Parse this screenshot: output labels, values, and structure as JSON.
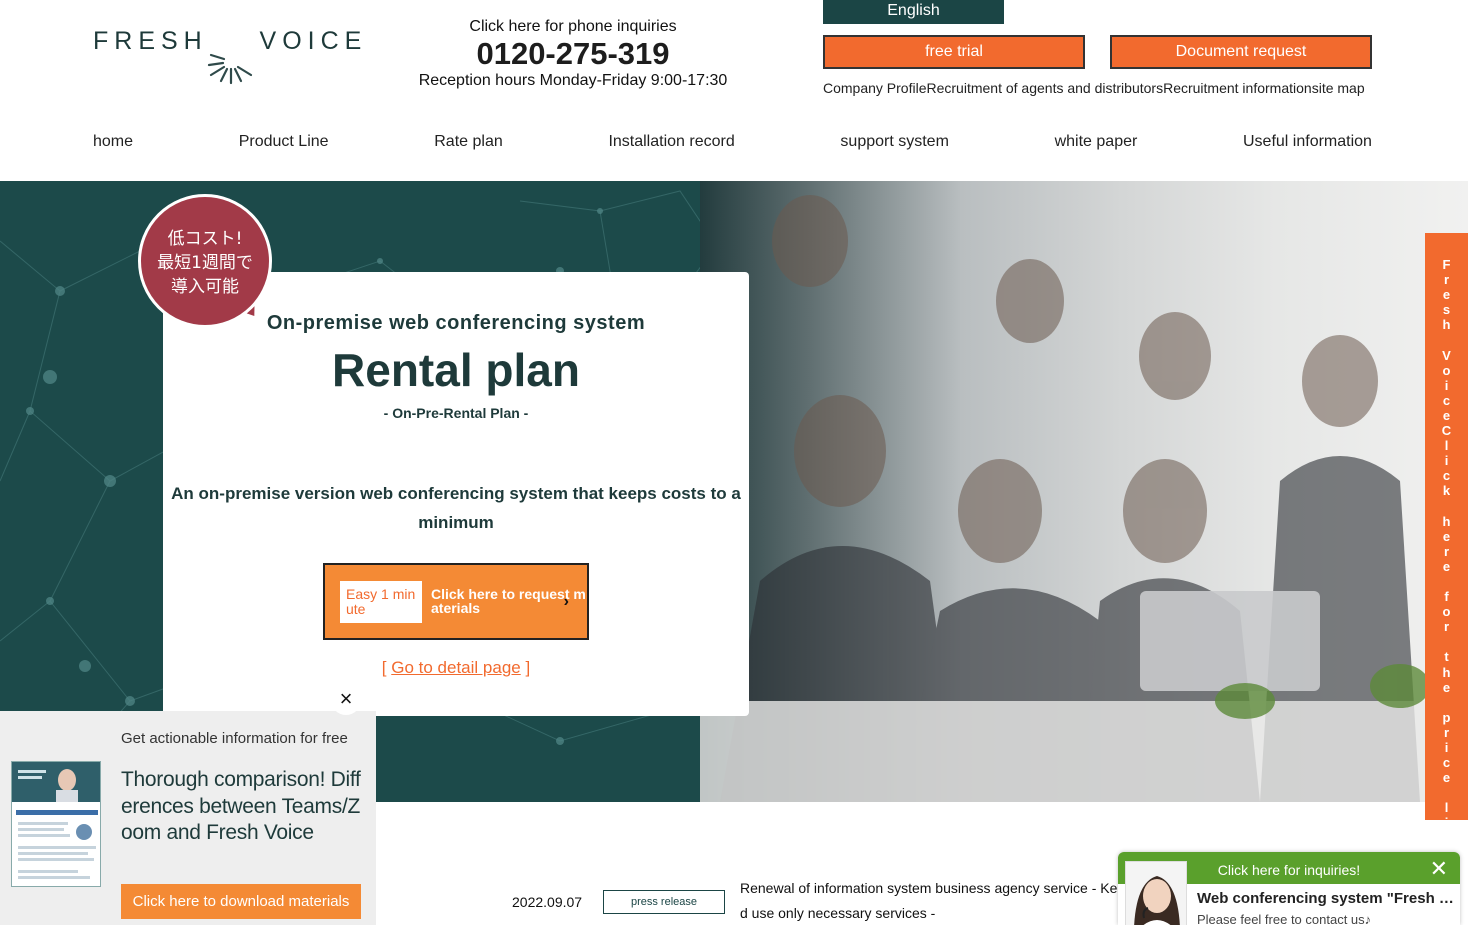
{
  "header": {
    "logo_left": "FRESH",
    "logo_right": "VOICE",
    "phone_lead": "Click here for phone inquiries",
    "phone_number": "0120-275-319",
    "phone_hours": "Reception hours Monday-Friday 9:00-17:30",
    "english_label": "English",
    "free_trial_label": "free trial",
    "document_request_label": "Document request",
    "util_links": [
      "Company Profile",
      "Recruitment of agents and distributors",
      "Recruitment information",
      "site map"
    ]
  },
  "nav": [
    "home",
    "Product Line",
    "Rate plan",
    "Installation record",
    "support system",
    "white paper",
    "Useful information"
  ],
  "hero": {
    "bubble_lines": [
      "低コスト!",
      "最短1週間で",
      "導入可能"
    ],
    "subtitle": "On-premise web conferencing system",
    "title": "Rental plan",
    "code": "- On-Pre-Rental Plan -",
    "description": "An on-premise version web conferencing system that keeps costs to a minimum",
    "request_badge": "Easy 1 minute",
    "request_text": "Click here to request materials",
    "detail_link": "Go to detail page"
  },
  "side_tab_text": "Fresh VoiceClick here for the price list of",
  "popup": {
    "lead": "Get actionable information for free",
    "title": "Thorough comparison! Differences between Teams/Zoom and Fresh Voice",
    "button": "Click here to download materials"
  },
  "news": {
    "date": "2022.09.07",
    "tag": "press release",
    "text": "Renewal of information system business agency service - Kend use only necessary services -"
  },
  "chat": {
    "header": "Click here for inquiries!",
    "title": "Web conferencing system \"Fresh Voice\"",
    "subtitle": "Please feel free to contact us♪"
  },
  "colors": {
    "brand_dark": "#1b4545",
    "accent_orange": "#f26a2e",
    "badge_red": "#a23a48",
    "chat_green": "#5aa02c"
  }
}
